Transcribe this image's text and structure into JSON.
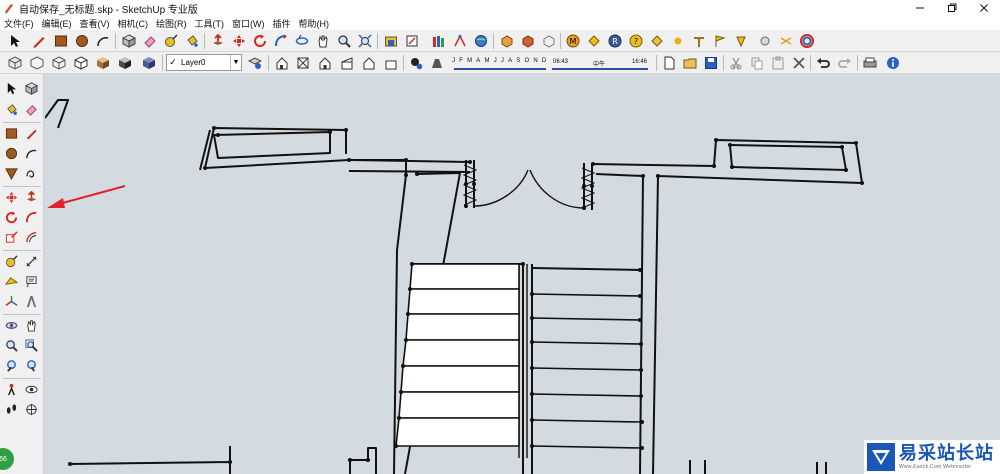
{
  "window": {
    "title": "自动保存_无标题.skp - SketchUp 专业版"
  },
  "menu": {
    "items": [
      "文件(F)",
      "编辑(E)",
      "查看(V)",
      "相机(C)",
      "绘图(R)",
      "工具(T)",
      "窗口(W)",
      "插件",
      "帮助(H)"
    ]
  },
  "layers": {
    "current": "Layer0"
  },
  "shadow": {
    "months": [
      "J",
      "F",
      "M",
      "A",
      "M",
      "J",
      "J",
      "A",
      "S",
      "O",
      "N",
      "D"
    ],
    "time_start": "06:43",
    "time_mid": "中午",
    "time_end": "16:46"
  },
  "status": {
    "badge": "66"
  },
  "watermark": {
    "cn": "易采站长站",
    "en": "Www.Easck.Com Webmaster"
  },
  "colors": {
    "canvas": "#d4dbe0",
    "toolbar": "#f0f0f0",
    "arrow": "#e0202a",
    "brand": "#1a57b8"
  }
}
